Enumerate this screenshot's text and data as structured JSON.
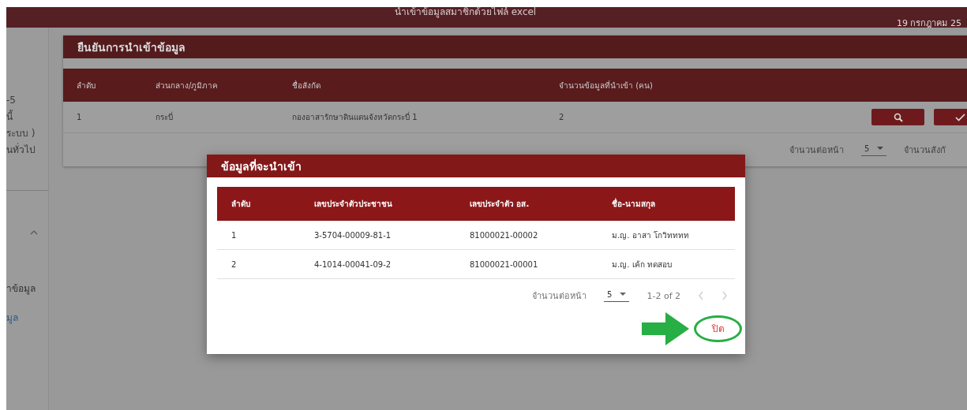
{
  "header": {
    "title": "นำเข้าข้อมูลสมาชิกด้วยไฟล์ excel",
    "date": "19 กรกฎาคม 25"
  },
  "sidebar": {
    "texts": [
      "-5",
      "นี้",
      "ระบบ )",
      "นทั่วไป"
    ],
    "menu": {
      "expanded": true,
      "items": [
        {
          "label": "าข้อมูล",
          "selected": false
        },
        {
          "label": "มูล",
          "selected": true
        }
      ]
    }
  },
  "import_card": {
    "title": "ยืนยันการนำเข้าข้อมูล",
    "columns": [
      "ลำดับ",
      "ส่วนกลาง/ภูมิภาค",
      "ชื่อสังกัด",
      "จำนวนข้อมูลที่นำเข้า (คน)"
    ],
    "rows": [
      {
        "cells": [
          "1",
          "กระบี่",
          "กองอาสารักษาดินแดนจังหวัดกระบี่ 1",
          "2"
        ]
      }
    ],
    "footer": {
      "rows_per_page_label": "จำนวนต่อหน้า",
      "rows_per_page": "5",
      "count_label": "จำนวนสังกั"
    }
  },
  "dialog": {
    "title": "ข้อมูลที่จะนำเข้า",
    "columns": [
      "ลำดับ",
      "เลขประจำตัวประชาชน",
      "เลขประจำตัว อส.",
      "ชื่อ-นามสกุล"
    ],
    "rows": [
      {
        "cells": [
          "1",
          "3-5704-00009-81-1",
          "81000021-00002",
          "ม.ญ. อาสา โกวิทททท"
        ]
      },
      {
        "cells": [
          "2",
          "4-1014-00041-09-2",
          "81000021-00001",
          "ม.ญ. เค้ก ทดสอบ"
        ]
      }
    ],
    "pagination": {
      "rows_per_page_label": "จำนวนต่อหน้า",
      "rows_per_page": "5",
      "range": "1-2 of 2",
      "prev_disabled": true,
      "next_disabled": true
    },
    "close_button": "ปิด"
  }
}
